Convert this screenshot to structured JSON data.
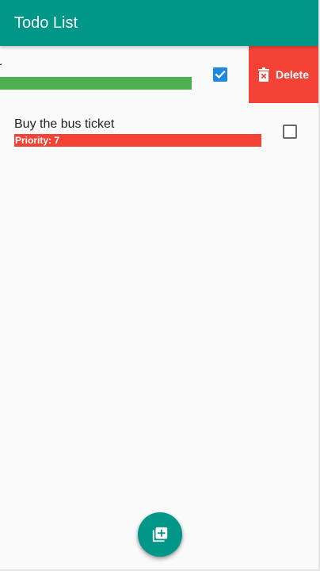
{
  "app": {
    "title": "Todo List"
  },
  "colors": {
    "app_bar": "#009688",
    "fab": "#009688",
    "delete_action": "#f44336",
    "priority_low": "#4caf50",
    "priority_high": "#f44336",
    "checkbox_checked": "#1e88e5"
  },
  "todos": [
    {
      "title": "er",
      "priority_label": "",
      "checked": true,
      "swiped": true,
      "action_label": "Delete",
      "action_icon": "trash-icon"
    },
    {
      "title": "Buy the bus ticket",
      "priority_label": "Priority: 7",
      "checked": false,
      "swiped": false
    }
  ],
  "fab": {
    "icon": "add-to-library-icon"
  }
}
